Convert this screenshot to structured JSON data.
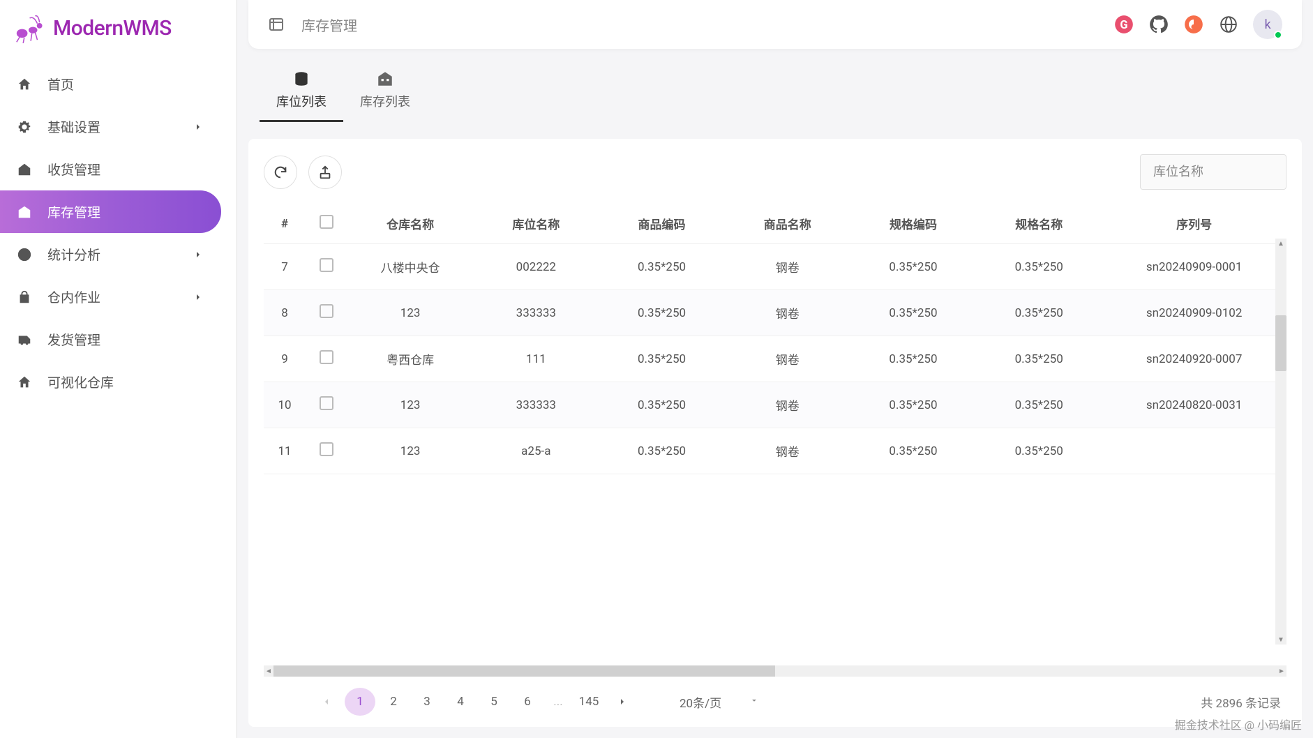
{
  "app": {
    "name": "ModernWMS"
  },
  "sidebar": {
    "items": [
      {
        "icon": "home",
        "label": "首页",
        "expandable": false,
        "active": false
      },
      {
        "icon": "gear",
        "label": "基础设置",
        "expandable": true,
        "active": false
      },
      {
        "icon": "inbound",
        "label": "收货管理",
        "expandable": false,
        "active": false
      },
      {
        "icon": "warehouse",
        "label": "库存管理",
        "expandable": false,
        "active": true
      },
      {
        "icon": "chart",
        "label": "统计分析",
        "expandable": true,
        "active": false
      },
      {
        "icon": "task",
        "label": "仓内作业",
        "expandable": true,
        "active": false
      },
      {
        "icon": "outbound",
        "label": "发货管理",
        "expandable": false,
        "active": false
      },
      {
        "icon": "home",
        "label": "可视化仓库",
        "expandable": false,
        "active": false
      }
    ]
  },
  "header": {
    "breadcrumb": "库存管理",
    "avatar_letter": "k"
  },
  "tabs": [
    {
      "icon": "stack",
      "label": "库位列表",
      "active": true
    },
    {
      "icon": "building",
      "label": "库存列表",
      "active": false
    }
  ],
  "search": {
    "placeholder": "库位名称"
  },
  "table": {
    "headers": [
      "#",
      "",
      "仓库名称",
      "库位名称",
      "商品编码",
      "商品名称",
      "规格编码",
      "规格名称",
      "序列号"
    ],
    "rows": [
      {
        "idx": "7",
        "warehouse": "八楼中央仓",
        "location": "002222",
        "sku_code": "0.35*250",
        "sku_name": "钢卷",
        "spec_code": "0.35*250",
        "spec_name": "0.35*250",
        "serial": "sn20240909-0001"
      },
      {
        "idx": "8",
        "warehouse": "123",
        "location": "333333",
        "sku_code": "0.35*250",
        "sku_name": "钢卷",
        "spec_code": "0.35*250",
        "spec_name": "0.35*250",
        "serial": "sn20240909-0102"
      },
      {
        "idx": "9",
        "warehouse": "粤西仓库",
        "location": "111",
        "sku_code": "0.35*250",
        "sku_name": "钢卷",
        "spec_code": "0.35*250",
        "spec_name": "0.35*250",
        "serial": "sn20240920-0007"
      },
      {
        "idx": "10",
        "warehouse": "123",
        "location": "333333",
        "sku_code": "0.35*250",
        "sku_name": "钢卷",
        "spec_code": "0.35*250",
        "spec_name": "0.35*250",
        "serial": "sn20240820-0031"
      },
      {
        "idx": "11",
        "warehouse": "123",
        "location": "a25-a",
        "sku_code": "0.35*250",
        "sku_name": "钢卷",
        "spec_code": "0.35*250",
        "spec_name": "0.35*250",
        "serial": ""
      }
    ]
  },
  "pagination": {
    "pages": [
      "1",
      "2",
      "3",
      "4",
      "5",
      "6"
    ],
    "last_page": "145",
    "active": "1",
    "page_size_label": "20条/页",
    "total_label": "共 2896 条记录"
  },
  "watermark": "掘金技术社区 @ 小码编匠"
}
